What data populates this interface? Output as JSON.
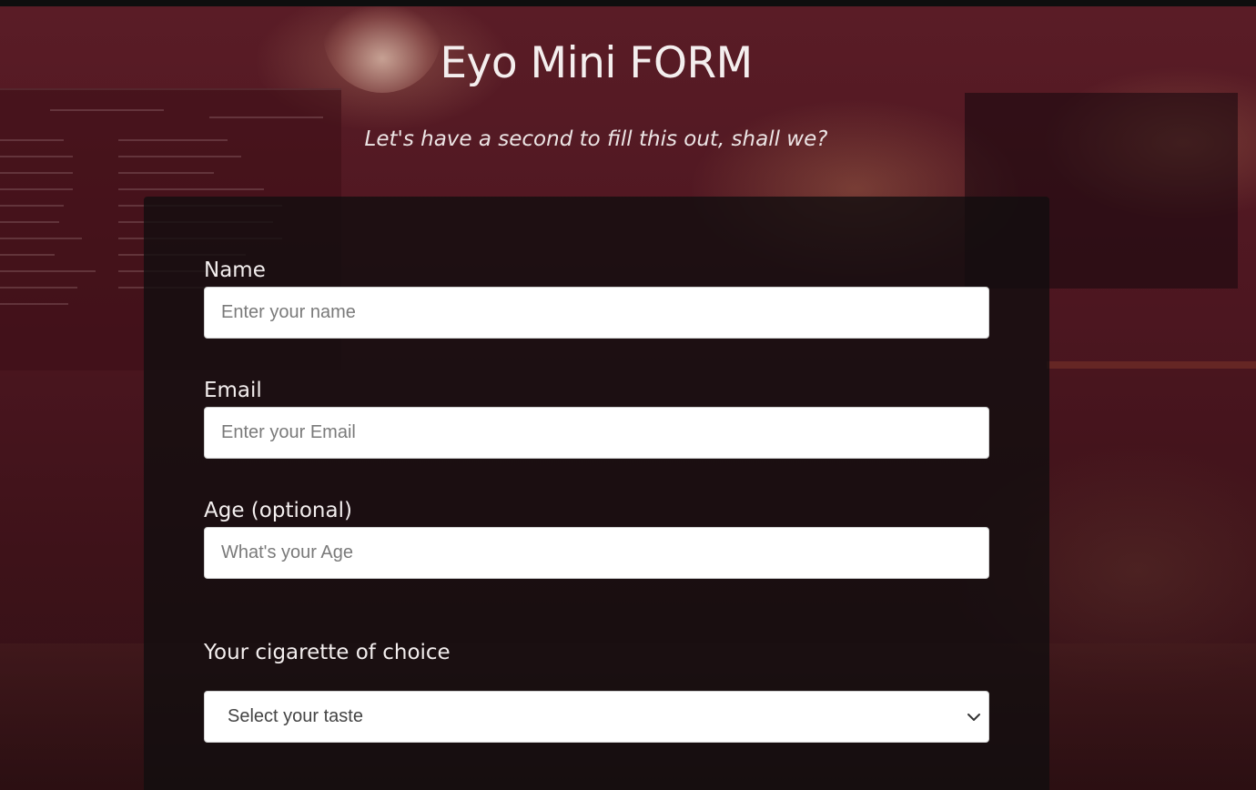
{
  "page": {
    "title": "Eyo Mini FORM",
    "subtitle": "Let's have a second to fill this out, shall we?"
  },
  "form": {
    "name": {
      "label": "Name",
      "placeholder": "Enter your name",
      "value": ""
    },
    "email": {
      "label": "Email",
      "placeholder": "Enter your Email",
      "value": ""
    },
    "age": {
      "label": "Age (optional)",
      "placeholder": "What's your Age",
      "value": ""
    },
    "cigarette": {
      "label": "Your cigarette of choice",
      "selected": "Select your taste",
      "icon": "chevron-down-icon"
    }
  },
  "colors": {
    "overlay": "#4c1620",
    "card": "#120e0f",
    "text": "#f3eeee"
  }
}
